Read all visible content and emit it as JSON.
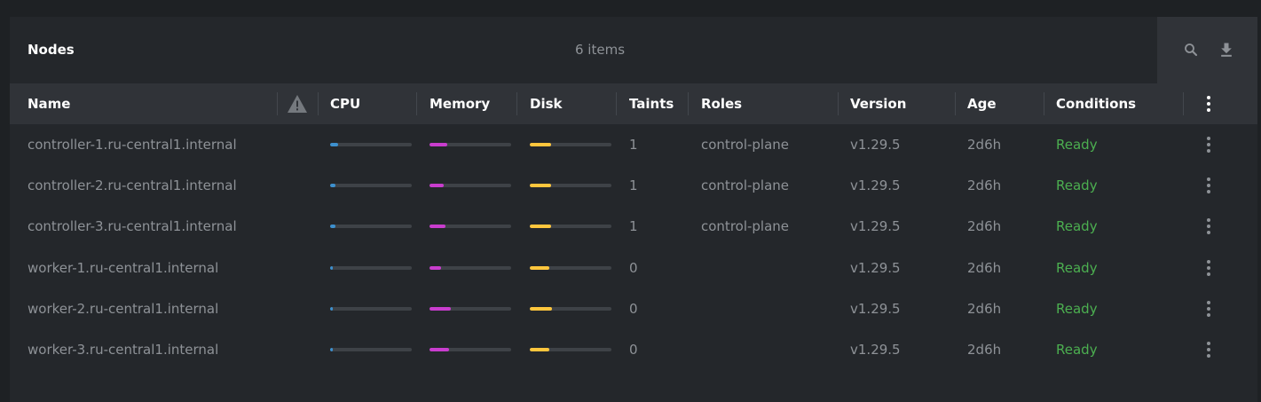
{
  "header": {
    "title": "Nodes",
    "count_text": "6 items"
  },
  "toolbar": {
    "search_icon": "search-icon",
    "download_icon": "download-icon"
  },
  "columns": {
    "name": "Name",
    "warning_icon": "warning-icon",
    "cpu": "CPU",
    "memory": "Memory",
    "disk": "Disk",
    "taints": "Taints",
    "roles": "Roles",
    "version": "Version",
    "age": "Age",
    "conditions": "Conditions",
    "menu_icon": "kebab-menu-icon"
  },
  "colors": {
    "cpu": "#3d90ce",
    "memory": "#c93dce",
    "disk": "#ffc63d",
    "ready": "#4caf50"
  },
  "rows": [
    {
      "name": "controller-1.ru-central1.internal",
      "cpu_pct": 10,
      "memory_pct": 22,
      "disk_pct": 26,
      "taints": "1",
      "roles": "control-plane",
      "version": "v1.29.5",
      "age": "2d6h",
      "condition": "Ready"
    },
    {
      "name": "controller-2.ru-central1.internal",
      "cpu_pct": 7,
      "memory_pct": 17,
      "disk_pct": 26,
      "taints": "1",
      "roles": "control-plane",
      "version": "v1.29.5",
      "age": "2d6h",
      "condition": "Ready"
    },
    {
      "name": "controller-3.ru-central1.internal",
      "cpu_pct": 6,
      "memory_pct": 20,
      "disk_pct": 26,
      "taints": "1",
      "roles": "control-plane",
      "version": "v1.29.5",
      "age": "2d6h",
      "condition": "Ready"
    },
    {
      "name": "worker-1.ru-central1.internal",
      "cpu_pct": 3,
      "memory_pct": 14,
      "disk_pct": 24,
      "taints": "0",
      "roles": "",
      "version": "v1.29.5",
      "age": "2d6h",
      "condition": "Ready"
    },
    {
      "name": "worker-2.ru-central1.internal",
      "cpu_pct": 3,
      "memory_pct": 26,
      "disk_pct": 27,
      "taints": "0",
      "roles": "",
      "version": "v1.29.5",
      "age": "2d6h",
      "condition": "Ready"
    },
    {
      "name": "worker-3.ru-central1.internal",
      "cpu_pct": 3,
      "memory_pct": 24,
      "disk_pct": 24,
      "taints": "0",
      "roles": "",
      "version": "v1.29.5",
      "age": "2d6h",
      "condition": "Ready"
    }
  ]
}
